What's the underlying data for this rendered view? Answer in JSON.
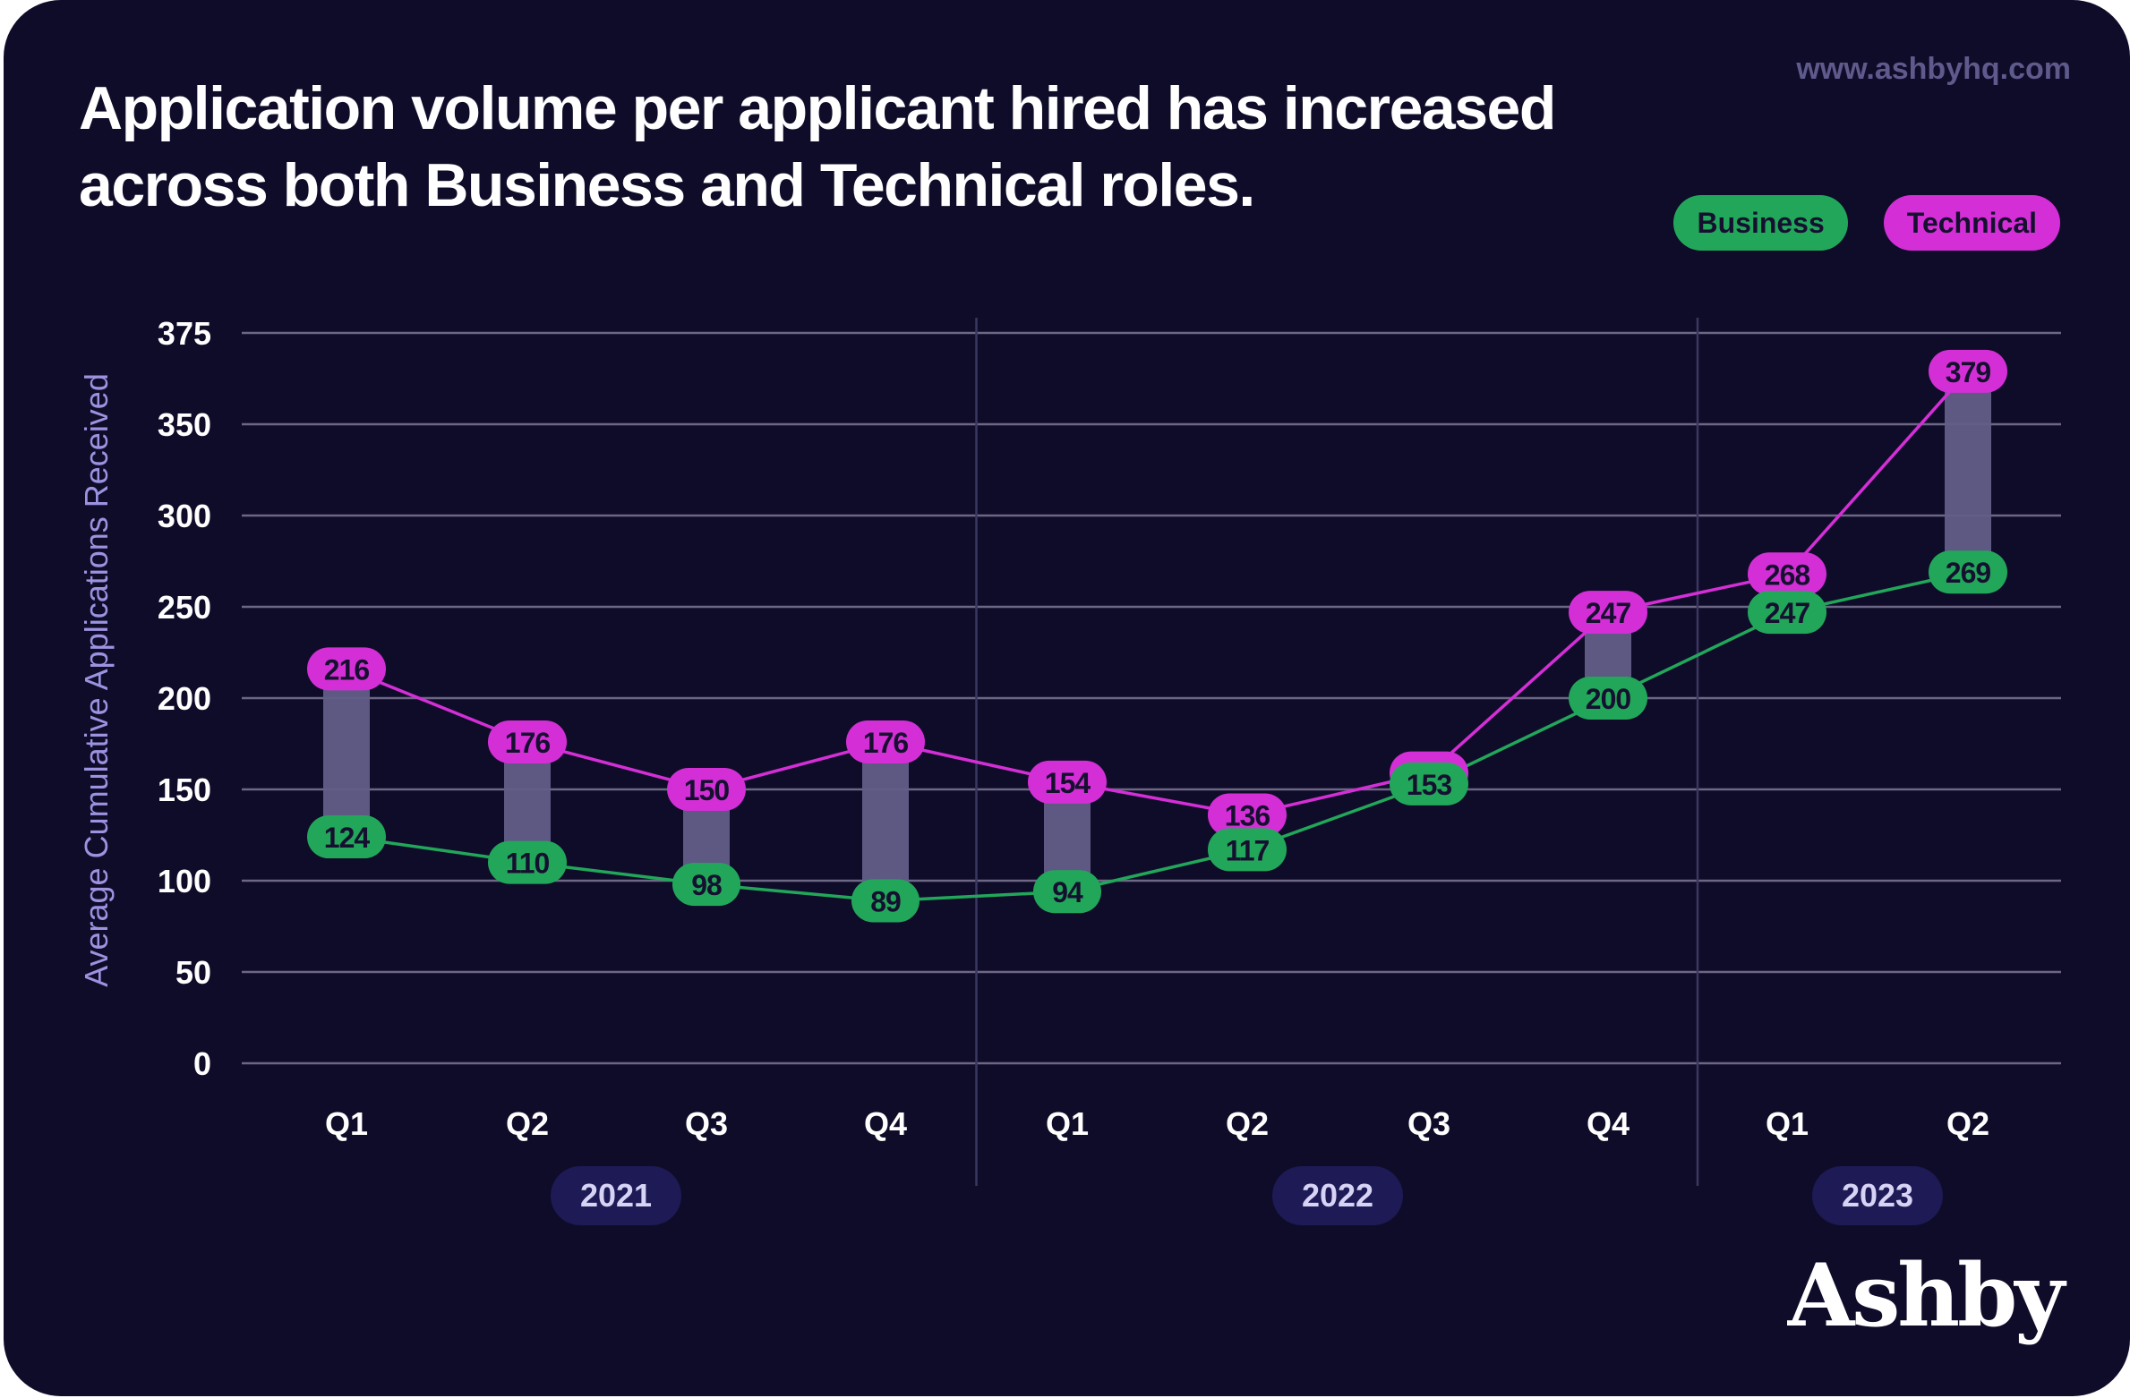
{
  "header": {
    "title": "Application volume per applicant hired has increased across both Business and Technical roles.",
    "site": "www.ashbyhq.com",
    "logo": "Ashby"
  },
  "legend": [
    {
      "label": "Business",
      "color": "#22a75a"
    },
    {
      "label": "Technical",
      "color": "#d42fd6"
    }
  ],
  "chart_data": {
    "type": "line",
    "title": "Application volume per applicant hired has increased across both Business and Technical roles.",
    "xlabel": "",
    "ylabel": "Average Cumulative Applications Received",
    "categories": [
      "Q1",
      "Q2",
      "Q3",
      "Q4",
      "Q1",
      "Q2",
      "Q3",
      "Q4",
      "Q1",
      "Q2"
    ],
    "groups": [
      {
        "label": "2021",
        "count": 4
      },
      {
        "label": "2022",
        "count": 4
      },
      {
        "label": "2023",
        "count": 2
      }
    ],
    "series": [
      {
        "name": "Business",
        "color": "#22a75a",
        "values": [
          124,
          110,
          98,
          89,
          94,
          117,
          153,
          200,
          247,
          269
        ]
      },
      {
        "name": "Technical",
        "color": "#d42fd6",
        "values": [
          216,
          176,
          150,
          176,
          154,
          136,
          159,
          247,
          268,
          379
        ],
        "hidden_labels": [
          6
        ]
      }
    ],
    "yticks": [
      {
        "value": 0,
        "label": "0"
      },
      {
        "value": 50,
        "label": "50"
      },
      {
        "value": 100,
        "label": "100"
      },
      {
        "value": 150,
        "label": "150"
      },
      {
        "value": 200,
        "label": "200"
      },
      {
        "value": 250,
        "label": "250"
      },
      {
        "value": 300,
        "label": "300"
      },
      {
        "value": 350,
        "label": "350"
      },
      {
        "value": 400,
        "label": "375"
      }
    ],
    "ylim": [
      0,
      400
    ],
    "grid": true,
    "legend_position": "top-right",
    "gap_bar_color": "#625e88"
  }
}
